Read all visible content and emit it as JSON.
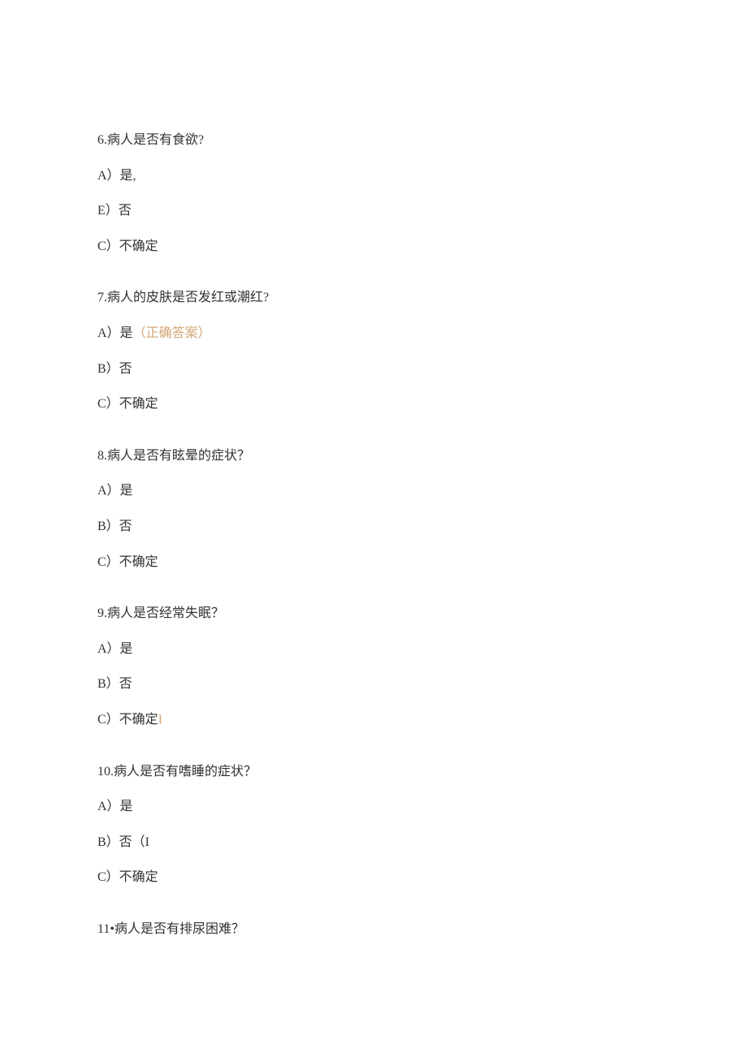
{
  "questions": [
    {
      "number": "6.",
      "text": "病人是否有食欲?",
      "options": [
        {
          "label": "A）是,",
          "suffix": "",
          "suffixClass": ""
        },
        {
          "label": "E）否",
          "suffix": "",
          "suffixClass": ""
        },
        {
          "label": "C）不确定",
          "suffix": "",
          "suffixClass": ""
        }
      ]
    },
    {
      "number": "7.",
      "text": "病人的皮肤是否发红或潮红?",
      "options": [
        {
          "label": "A）是",
          "suffix": "（正确答案）",
          "suffixClass": "correct-answer"
        },
        {
          "label": "B）否",
          "suffix": "",
          "suffixClass": ""
        },
        {
          "label": "C）不确定",
          "suffix": "",
          "suffixClass": ""
        }
      ]
    },
    {
      "number": "8.",
      "text": "病人是否有眩晕的症状？",
      "options": [
        {
          "label": "A）是",
          "suffix": "",
          "suffixClass": ""
        },
        {
          "label": "B）否",
          "suffix": "",
          "suffixClass": ""
        },
        {
          "label": "C）不确定",
          "suffix": "",
          "suffixClass": ""
        }
      ]
    },
    {
      "number": "9.",
      "text": "病人是否经常失眠？",
      "options": [
        {
          "label": "A）是",
          "suffix": "",
          "suffixClass": ""
        },
        {
          "label": "B）否",
          "suffix": "",
          "suffixClass": ""
        },
        {
          "label": "C）不确定",
          "suffix": "I",
          "suffixClass": "orange-char"
        }
      ]
    },
    {
      "number": "10.",
      "text": "病人是否有嗜睡的症状？",
      "options": [
        {
          "label": "A）是",
          "suffix": "",
          "suffixClass": ""
        },
        {
          "label": "B）否（I",
          "suffix": "",
          "suffixClass": ""
        },
        {
          "label": "C）不确定",
          "suffix": "",
          "suffixClass": ""
        }
      ]
    },
    {
      "number": "11•",
      "text": "病人是否有排尿困难？",
      "options": []
    }
  ]
}
